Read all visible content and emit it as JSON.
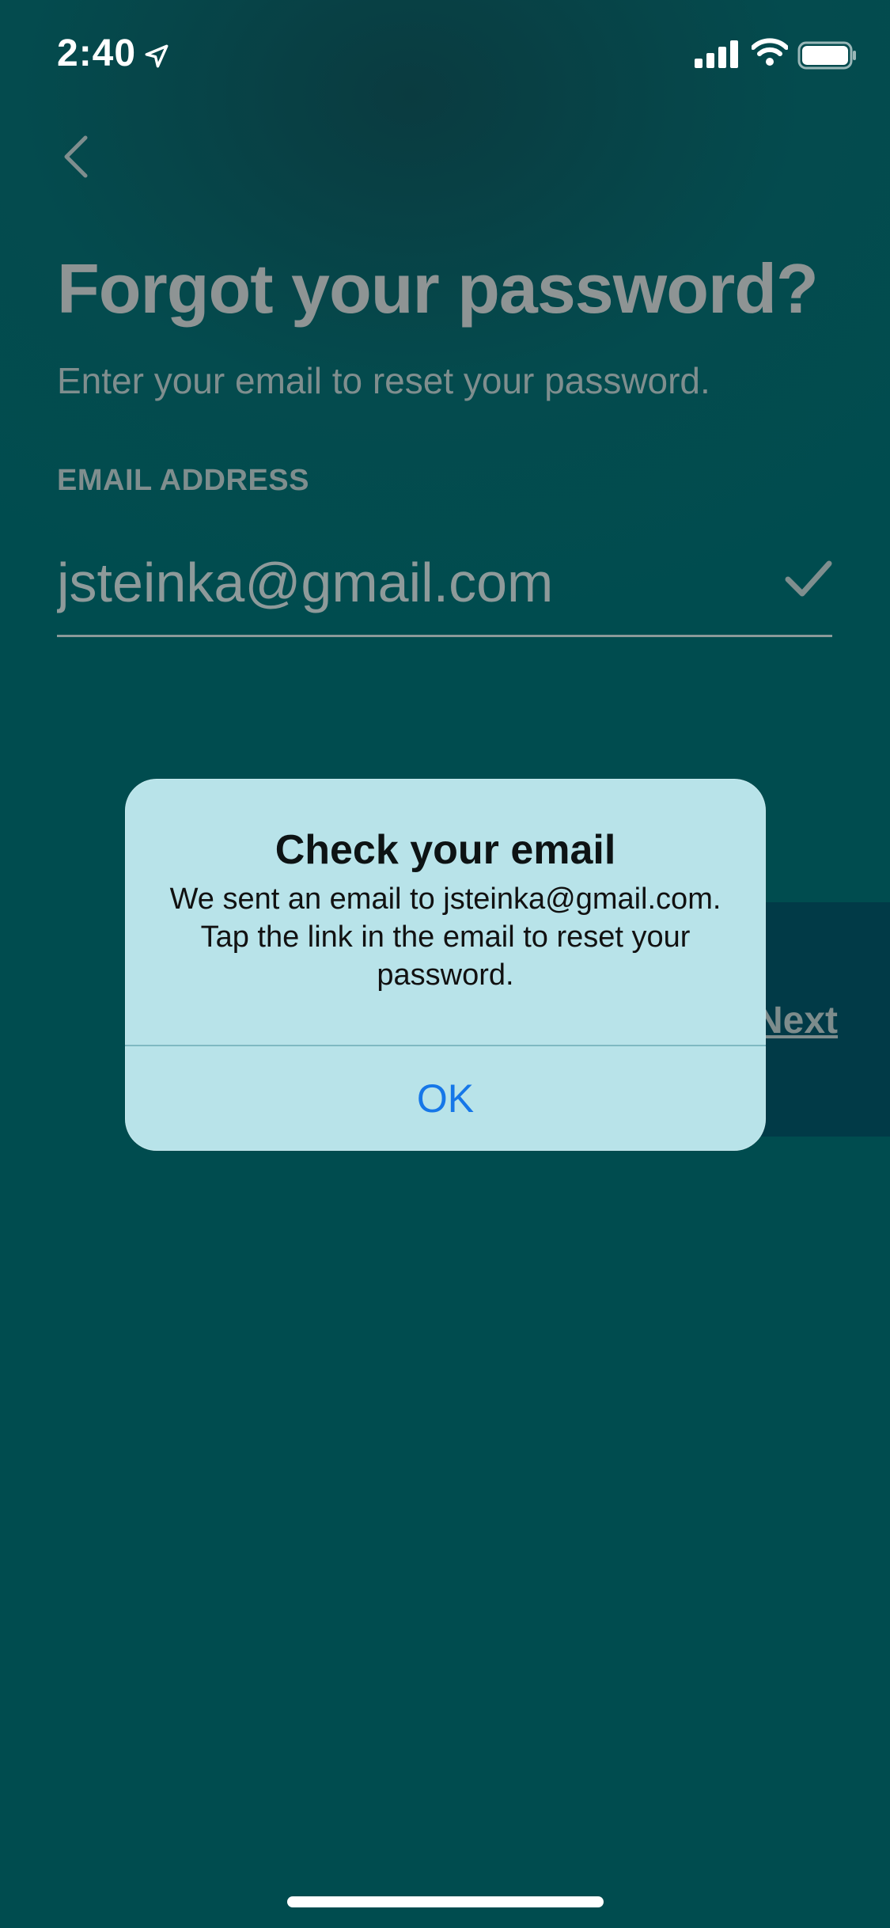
{
  "status_bar": {
    "time": "2:40",
    "icons": [
      "location-arrow-icon",
      "cellular-signal-icon",
      "wifi-icon",
      "battery-icon"
    ]
  },
  "nav": {
    "back_icon": "chevron-left-icon"
  },
  "screen": {
    "title": "Forgot your password?",
    "subtitle": "Enter your email to reset your password.",
    "email_label": "EMAIL ADDRESS",
    "email_value": "jsteinka@gmail.com",
    "email_valid_icon": "checkmark-icon",
    "next_label": "Next"
  },
  "alert": {
    "title": "Check your email",
    "message": "We sent an email to jsteinka@gmail.com. Tap the link in the email to reset your password.",
    "ok_label": "OK"
  },
  "colors": {
    "accent": "#1677e8",
    "background": "#004c4f",
    "alert_bg": "#b8e3e9"
  }
}
